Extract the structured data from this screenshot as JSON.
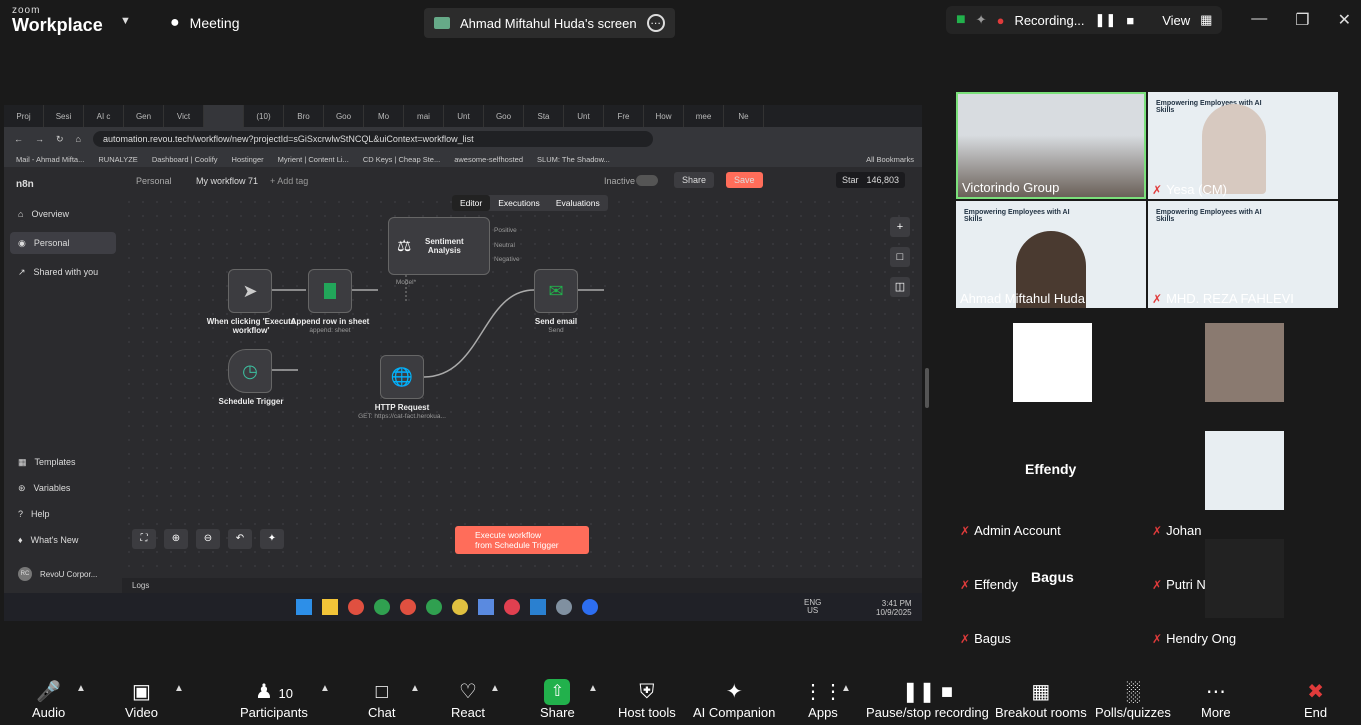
{
  "app": {
    "brand_top": "zoom",
    "brand_main": "Workplace",
    "meeting_label": "Meeting",
    "screen_label": "Ahmad Miftahul Huda's screen",
    "recording_label": "Recording...",
    "view_label": "View"
  },
  "browser": {
    "tabs": [
      "Proj",
      "Sesi",
      "AI c",
      "Gen",
      "Vict",
      "",
      "(10)",
      "Bro",
      "Goo",
      "Mo",
      "mai",
      "Unt",
      "Goo",
      "Sta",
      "Unt",
      "Fre",
      "How",
      "mee",
      "Ne"
    ],
    "url": "automation.revou.tech/workflow/new?projectId=sGiSxcrwlwStNCQL&uiContext=workflow_list",
    "bookmarks": [
      "Mail - Ahmad Mifta...",
      "RUNALYZE",
      "Dashboard | Coolify",
      "Hostinger",
      "Myrient | Content Li...",
      "CD Keys | Cheap Ste...",
      "awesome-selfhosted",
      "SLUM: The Shadow..."
    ],
    "all_bookmarks": "All Bookmarks"
  },
  "n8n": {
    "logo": "n8n",
    "sidebar": {
      "overview": "Overview",
      "personal": "Personal",
      "shared": "Shared with you",
      "templates": "Templates",
      "variables": "Variables",
      "help": "Help",
      "whats_new": "What's New",
      "account": "RevoU Corpor...",
      "account_initials": "RC"
    },
    "header": {
      "breadcrumb": "Personal",
      "workflow_name": "My workflow 71",
      "add_tag": "+ Add tag",
      "inactive": "Inactive",
      "share": "Share",
      "save": "Save",
      "star": "Star",
      "star_count": "146,803"
    },
    "tabs": [
      "Editor",
      "Executions",
      "Evaluations"
    ],
    "nodes": {
      "trigger_manual": "When clicking 'Execute workflow'",
      "append_row": "Append row in sheet",
      "append_row_sub": "append: sheet",
      "sentiment": "Sentiment Analysis",
      "sentiment_outputs": [
        "Positive",
        "Neutral",
        "Negative"
      ],
      "sentiment_model": "Model*",
      "send_email": "Send email",
      "send_email_sub": "Send",
      "schedule": "Schedule Trigger",
      "http": "HTTP Request",
      "http_sub": "GET: https://cat-fact.herokua..."
    },
    "execute": {
      "line1": "Execute workflow",
      "line2": "from Schedule Trigger"
    },
    "logs": "Logs"
  },
  "taskbar": {
    "lang1": "ENG",
    "lang2": "US",
    "time": "3:41 PM",
    "date": "10/9/2025"
  },
  "participants": [
    {
      "name": "Victorindo Group",
      "muted": false
    },
    {
      "name": "Yesa (CM)",
      "muted": true
    },
    {
      "name": "Ahmad Miftahul Huda",
      "muted": false
    },
    {
      "name": "MHD. REZA FAHLEVI",
      "muted": true
    },
    {
      "name": "Admin Account",
      "muted": true
    },
    {
      "name": "Johan",
      "muted": true
    },
    {
      "name": "Effendy",
      "muted": true,
      "big": "Effendy"
    },
    {
      "name": "Putri Nur Isha",
      "muted": true
    },
    {
      "name": "Bagus",
      "muted": true,
      "big": "Bagus"
    },
    {
      "name": "Hendry Ong",
      "muted": true
    }
  ],
  "slide_title": "Empowering Employees with AI Skills",
  "toolbar": {
    "audio": "Audio",
    "video": "Video",
    "participants": "Participants",
    "participants_count": "10",
    "chat": "Chat",
    "react": "React",
    "share": "Share",
    "host_tools": "Host tools",
    "ai_companion": "AI Companion",
    "apps": "Apps",
    "pause_rec": "Pause/stop recording",
    "breakout": "Breakout rooms",
    "polls": "Polls/quizzes",
    "more": "More",
    "end": "End"
  },
  "colors": {
    "bg": "#1a1a1a",
    "share_green": "#22b14c",
    "n8n_orange": "#ff6d5a",
    "end_red": "#e03b3b",
    "tile_border": "#7be07b"
  }
}
